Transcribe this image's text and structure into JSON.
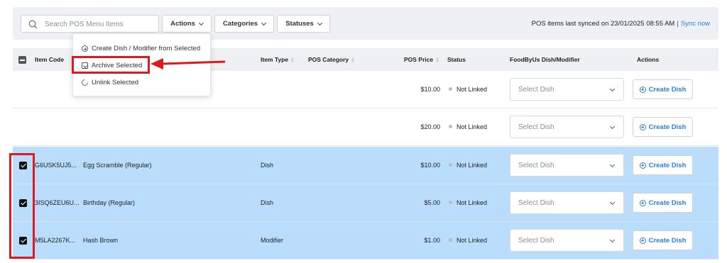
{
  "toolbar": {
    "search_placeholder": "Search POS Menu Items",
    "actions_label": "Actions",
    "categories_label": "Categories",
    "statuses_label": "Statuses",
    "sync_text": "POS items last synced on 23/01/2025 08:55 AM",
    "sync_separator": "|",
    "sync_link": "Sync now"
  },
  "actions_menu": {
    "items": [
      {
        "label": "Create Dish / Modifier from Selected",
        "icon": "circle-plus-icon"
      },
      {
        "label": "Archive Selected",
        "icon": "archive-icon"
      },
      {
        "label": "Unlink Selected",
        "icon": "unlink-icon"
      }
    ]
  },
  "table": {
    "columns": [
      "Item Code",
      "Item Type",
      "POS Category",
      "POS Price",
      "Status",
      "FoodByUs Dish/Modifier",
      "Actions"
    ],
    "rows": [
      {
        "code": "",
        "name": "",
        "type": "",
        "category": "",
        "price": "$10.00",
        "status": "Not Linked",
        "dish_placeholder": "Select Dish",
        "action": "Create Dish",
        "selected": false
      },
      {
        "code": "",
        "name": "",
        "type": "",
        "category": "",
        "price": "$20.00",
        "status": "Not Linked",
        "dish_placeholder": "Select Dish",
        "action": "Create Dish",
        "selected": false
      },
      {
        "code": "G6USK5UJ5...",
        "name": "Egg Scramble (Regular)",
        "type": "Dish",
        "category": "",
        "price": "$10.00",
        "status": "Not Linked",
        "dish_placeholder": "Select Dish",
        "action": "Create Dish",
        "selected": true
      },
      {
        "code": "3ISQ6ZEU6U...",
        "name": "Birthday (Regular)",
        "type": "Dish",
        "category": "",
        "price": "$5.00",
        "status": "Not Linked",
        "dish_placeholder": "Select Dish",
        "action": "Create Dish",
        "selected": true
      },
      {
        "code": "M5LA2267K...",
        "name": "Hash Brown",
        "type": "Modifier",
        "category": "",
        "price": "$1.00",
        "status": "Not Linked",
        "dish_placeholder": "Select Dish",
        "action": "Create Dish",
        "selected": true
      }
    ]
  },
  "colors": {
    "accent": "#2d7fd9",
    "selected_row": "#bbddfc",
    "highlight": "#e0191e"
  }
}
